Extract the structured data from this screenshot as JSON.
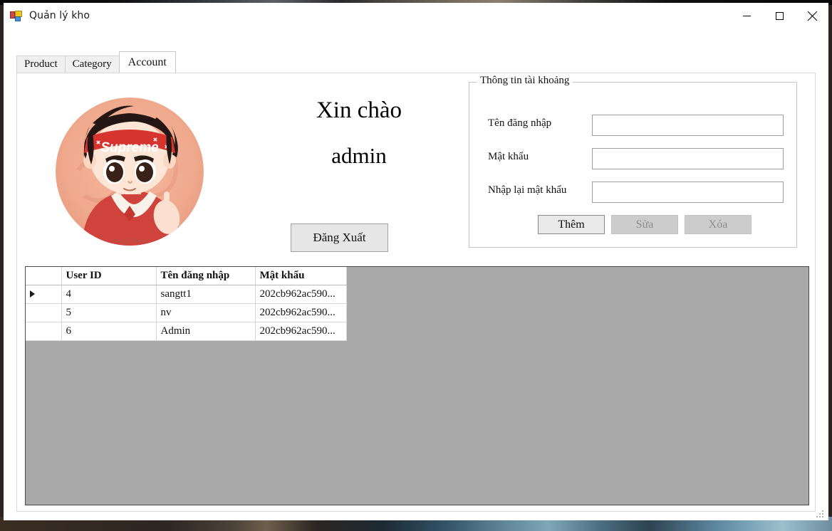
{
  "window": {
    "title": "Quản lý kho",
    "icon": "winforms-app-icon",
    "controls": {
      "minimize": "minimize-icon",
      "maximize": "maximize-icon",
      "close": "close-icon"
    }
  },
  "tabs": [
    {
      "label": "Product",
      "selected": false
    },
    {
      "label": "Category",
      "selected": false
    },
    {
      "label": "Account",
      "selected": true
    }
  ],
  "account_tab": {
    "avatar": "user-avatar-chibi-supreme",
    "greeting": {
      "line1": "Xin chào",
      "line2": "admin"
    },
    "logout_button": "Đăng Xuất",
    "groupbox": {
      "legend": "Thông tin tài khoảng",
      "fields": [
        {
          "label": "Tên đăng nhập",
          "value": "",
          "placeholder": ""
        },
        {
          "label": "Mật khẩu",
          "value": "",
          "placeholder": ""
        },
        {
          "label": "Nhập lại mật khẩu",
          "value": "",
          "placeholder": ""
        }
      ],
      "buttons": [
        {
          "label": "Thêm",
          "enabled": true
        },
        {
          "label": "Sửa",
          "enabled": false
        },
        {
          "label": "Xóa",
          "enabled": false
        }
      ]
    },
    "grid": {
      "columns": [
        "",
        "User ID",
        "Tên đăng nhập",
        "Mật khẩu"
      ],
      "rows": [
        {
          "marker": true,
          "selected": true,
          "user_id": "4",
          "username": "sangtt1",
          "password": "202cb962ac590..."
        },
        {
          "marker": false,
          "selected": false,
          "user_id": "5",
          "username": "nv",
          "password": "202cb962ac590..."
        },
        {
          "marker": false,
          "selected": false,
          "user_id": "6",
          "username": "Admin",
          "password": "202cb962ac590..."
        }
      ],
      "selection_color": "#0b7ad4",
      "background_color": "#a9a9a9"
    }
  }
}
